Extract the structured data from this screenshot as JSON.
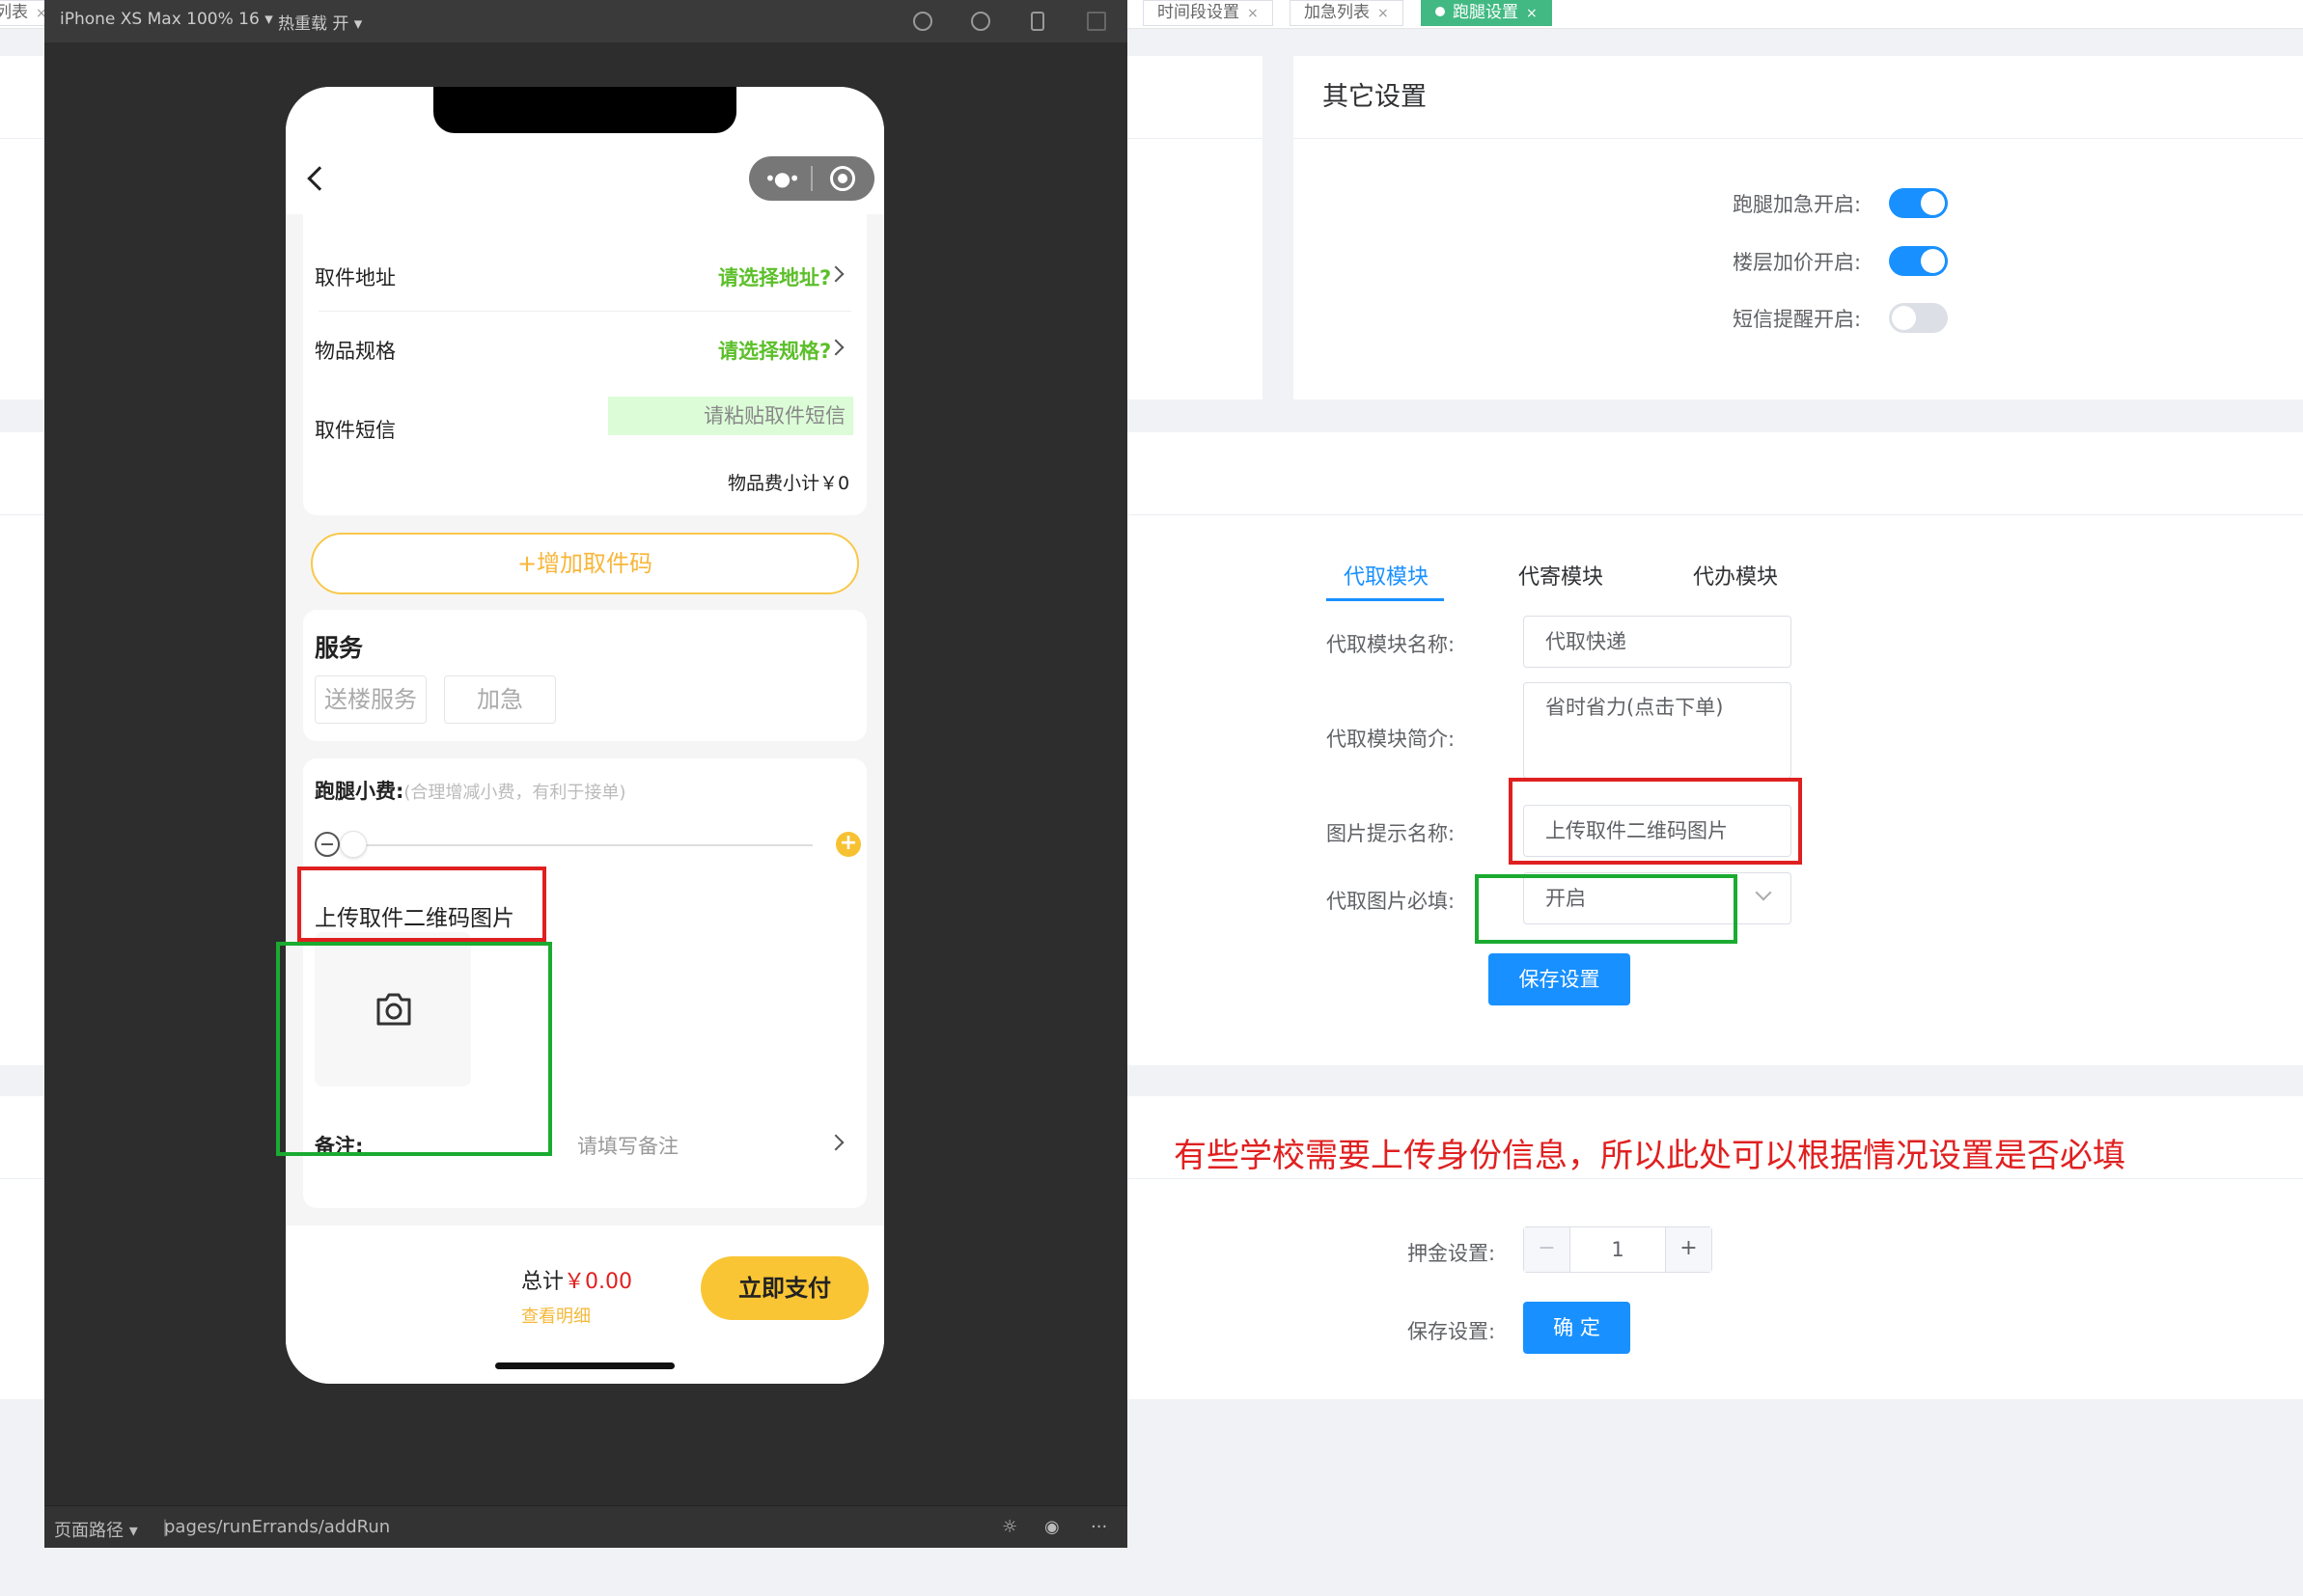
{
  "tabs": [
    {
      "label": "列表"
    },
    {
      "label": "时间段设置"
    },
    {
      "label": "加急列表"
    },
    {
      "label": "跑腿设置",
      "active": true
    }
  ],
  "simulator": {
    "device": "iPhone XS Max 100% 16 ▾",
    "hot_reload": "热重载 开 ▾",
    "path_label": "页面路径 ▾",
    "path_value": "pages/runErrands/addRun"
  },
  "phone": {
    "pickup_address_label": "取件地址",
    "pickup_address_value": "请选择地址?",
    "spec_label": "物品规格",
    "spec_value": "请选择规格?",
    "sms_label": "取件短信",
    "sms_placeholder": "请粘贴取件短信",
    "subtotal": "物品费小计￥0",
    "add_code": "+增加取件码",
    "service_title": "服务",
    "service_tags": [
      "送楼服务",
      "加急"
    ],
    "tip_title": "跑腿小费:",
    "tip_hint": "(合理增减小费，有利于接单)",
    "upload_title": "上传取件二维码图片",
    "remark_label": "备注:",
    "remark_placeholder": "请填写备注",
    "total_label": "总计",
    "total_value": "￥0.00",
    "detail_link": "查看明细",
    "pay_button": "立即支付"
  },
  "other_settings": {
    "title": "其它设置",
    "items": [
      {
        "label": "跑腿加急开启:",
        "on": true
      },
      {
        "label": "楼层加价开启:",
        "on": true
      },
      {
        "label": "短信提醒开启:",
        "on": false
      }
    ]
  },
  "module_settings": {
    "tabs": [
      "代取模块",
      "代寄模块",
      "代办模块"
    ],
    "active_tab": 0,
    "name_label": "代取模块名称:",
    "name_value": "代取快递",
    "intro_label": "代取模块简介:",
    "intro_value": "省时省力(点击下单)",
    "image_hint_label": "图片提示名称:",
    "image_hint_value": "上传取件二维码图片",
    "image_required_label": "代取图片必填:",
    "image_required_value": "开启",
    "save_button": "保存设置"
  },
  "annotation": "有些学校需要上传身份信息，所以此处可以根据情况设置是否必填",
  "deposit": {
    "label": "押金设置:",
    "minus": "−",
    "value": "1",
    "plus": "+",
    "save_label": "保存设置:",
    "confirm_button": "确 定"
  },
  "colors": {
    "primary": "#1890ff",
    "active_tab": "#42b983",
    "highlight_red": "#e02020",
    "highlight_green": "#1aab30",
    "phone_green_text": "#5cbf2a",
    "pay_yellow": "#f9c534"
  }
}
